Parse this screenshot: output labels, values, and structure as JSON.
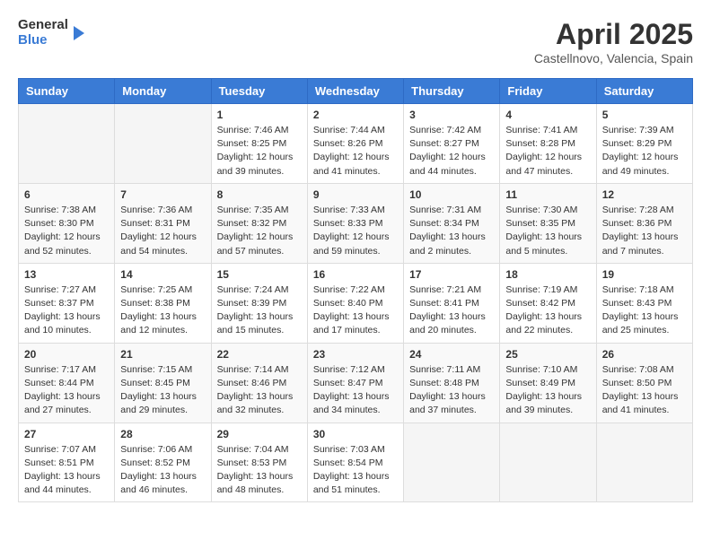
{
  "logo": {
    "general": "General",
    "blue": "Blue"
  },
  "header": {
    "title": "April 2025",
    "subtitle": "Castellnovo, Valencia, Spain"
  },
  "weekdays": [
    "Sunday",
    "Monday",
    "Tuesday",
    "Wednesday",
    "Thursday",
    "Friday",
    "Saturday"
  ],
  "weeks": [
    [
      {
        "day": "",
        "info": ""
      },
      {
        "day": "",
        "info": ""
      },
      {
        "day": "1",
        "sunrise": "7:46 AM",
        "sunset": "8:25 PM",
        "daylight": "12 hours and 39 minutes."
      },
      {
        "day": "2",
        "sunrise": "7:44 AM",
        "sunset": "8:26 PM",
        "daylight": "12 hours and 41 minutes."
      },
      {
        "day": "3",
        "sunrise": "7:42 AM",
        "sunset": "8:27 PM",
        "daylight": "12 hours and 44 minutes."
      },
      {
        "day": "4",
        "sunrise": "7:41 AM",
        "sunset": "8:28 PM",
        "daylight": "12 hours and 47 minutes."
      },
      {
        "day": "5",
        "sunrise": "7:39 AM",
        "sunset": "8:29 PM",
        "daylight": "12 hours and 49 minutes."
      }
    ],
    [
      {
        "day": "6",
        "sunrise": "7:38 AM",
        "sunset": "8:30 PM",
        "daylight": "12 hours and 52 minutes."
      },
      {
        "day": "7",
        "sunrise": "7:36 AM",
        "sunset": "8:31 PM",
        "daylight": "12 hours and 54 minutes."
      },
      {
        "day": "8",
        "sunrise": "7:35 AM",
        "sunset": "8:32 PM",
        "daylight": "12 hours and 57 minutes."
      },
      {
        "day": "9",
        "sunrise": "7:33 AM",
        "sunset": "8:33 PM",
        "daylight": "12 hours and 59 minutes."
      },
      {
        "day": "10",
        "sunrise": "7:31 AM",
        "sunset": "8:34 PM",
        "daylight": "13 hours and 2 minutes."
      },
      {
        "day": "11",
        "sunrise": "7:30 AM",
        "sunset": "8:35 PM",
        "daylight": "13 hours and 5 minutes."
      },
      {
        "day": "12",
        "sunrise": "7:28 AM",
        "sunset": "8:36 PM",
        "daylight": "13 hours and 7 minutes."
      }
    ],
    [
      {
        "day": "13",
        "sunrise": "7:27 AM",
        "sunset": "8:37 PM",
        "daylight": "13 hours and 10 minutes."
      },
      {
        "day": "14",
        "sunrise": "7:25 AM",
        "sunset": "8:38 PM",
        "daylight": "13 hours and 12 minutes."
      },
      {
        "day": "15",
        "sunrise": "7:24 AM",
        "sunset": "8:39 PM",
        "daylight": "13 hours and 15 minutes."
      },
      {
        "day": "16",
        "sunrise": "7:22 AM",
        "sunset": "8:40 PM",
        "daylight": "13 hours and 17 minutes."
      },
      {
        "day": "17",
        "sunrise": "7:21 AM",
        "sunset": "8:41 PM",
        "daylight": "13 hours and 20 minutes."
      },
      {
        "day": "18",
        "sunrise": "7:19 AM",
        "sunset": "8:42 PM",
        "daylight": "13 hours and 22 minutes."
      },
      {
        "day": "19",
        "sunrise": "7:18 AM",
        "sunset": "8:43 PM",
        "daylight": "13 hours and 25 minutes."
      }
    ],
    [
      {
        "day": "20",
        "sunrise": "7:17 AM",
        "sunset": "8:44 PM",
        "daylight": "13 hours and 27 minutes."
      },
      {
        "day": "21",
        "sunrise": "7:15 AM",
        "sunset": "8:45 PM",
        "daylight": "13 hours and 29 minutes."
      },
      {
        "day": "22",
        "sunrise": "7:14 AM",
        "sunset": "8:46 PM",
        "daylight": "13 hours and 32 minutes."
      },
      {
        "day": "23",
        "sunrise": "7:12 AM",
        "sunset": "8:47 PM",
        "daylight": "13 hours and 34 minutes."
      },
      {
        "day": "24",
        "sunrise": "7:11 AM",
        "sunset": "8:48 PM",
        "daylight": "13 hours and 37 minutes."
      },
      {
        "day": "25",
        "sunrise": "7:10 AM",
        "sunset": "8:49 PM",
        "daylight": "13 hours and 39 minutes."
      },
      {
        "day": "26",
        "sunrise": "7:08 AM",
        "sunset": "8:50 PM",
        "daylight": "13 hours and 41 minutes."
      }
    ],
    [
      {
        "day": "27",
        "sunrise": "7:07 AM",
        "sunset": "8:51 PM",
        "daylight": "13 hours and 44 minutes."
      },
      {
        "day": "28",
        "sunrise": "7:06 AM",
        "sunset": "8:52 PM",
        "daylight": "13 hours and 46 minutes."
      },
      {
        "day": "29",
        "sunrise": "7:04 AM",
        "sunset": "8:53 PM",
        "daylight": "13 hours and 48 minutes."
      },
      {
        "day": "30",
        "sunrise": "7:03 AM",
        "sunset": "8:54 PM",
        "daylight": "13 hours and 51 minutes."
      },
      {
        "day": "",
        "info": ""
      },
      {
        "day": "",
        "info": ""
      },
      {
        "day": "",
        "info": ""
      }
    ]
  ],
  "labels": {
    "sunrise_prefix": "Sunrise: ",
    "sunset_prefix": "Sunset: ",
    "daylight_prefix": "Daylight: "
  }
}
